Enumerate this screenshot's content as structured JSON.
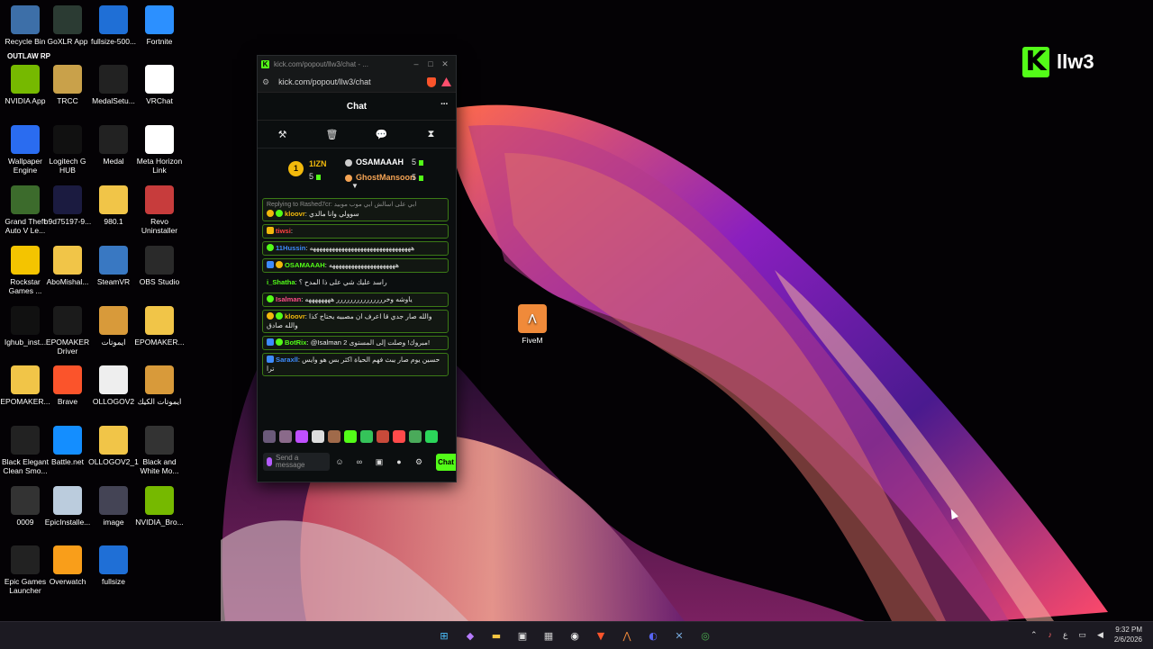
{
  "desktop": {
    "icons": [
      {
        "label": "Recycle Bin",
        "icon": "recycle-bin-icon",
        "color": "#3d6fa8"
      },
      {
        "label": "GoXLR App",
        "icon": "goxlr-icon",
        "color": "#2b3b33"
      },
      {
        "label": "fullsize-500...",
        "icon": "olontop-icon",
        "color": "#1f6fd6"
      },
      {
        "label": "Fortnite",
        "icon": "fortnite-icon",
        "color": "#2c90ff"
      },
      {
        "label": "NVIDIA App",
        "icon": "nvidia-icon",
        "color": "#76b900"
      },
      {
        "label": "TRCC",
        "icon": "trcc-icon",
        "color": "#c9a14a"
      },
      {
        "label": "MedalSetu...",
        "icon": "medal-icon",
        "color": "#222"
      },
      {
        "label": "VRChat",
        "icon": "vrchat-icon",
        "color": "#ffffff"
      },
      {
        "label": "Wallpaper Engine",
        "icon": "wallpaper-engine-icon",
        "color": "#2a6cf0"
      },
      {
        "label": "Logitech G HUB",
        "icon": "logitech-icon",
        "color": "#111"
      },
      {
        "label": "Medal",
        "icon": "medal-icon",
        "color": "#222"
      },
      {
        "label": "Meta Horizon Link",
        "icon": "meta-icon",
        "color": "#ffffff"
      },
      {
        "label": "Grand Theft Auto V Le...",
        "icon": "gta-icon",
        "color": "#3c6b2c"
      },
      {
        "label": "b9d75197-9...",
        "icon": "file-icon",
        "color": "#1b1b40"
      },
      {
        "label": "980.1",
        "icon": "folder-icon",
        "color": "#f1c548"
      },
      {
        "label": "Revo Uninstaller",
        "icon": "revo-icon",
        "color": "#c73c3c"
      },
      {
        "label": "Rockstar Games ...",
        "icon": "rockstar-icon",
        "color": "#f4c400"
      },
      {
        "label": "AboMishal...",
        "icon": "folder-icon",
        "color": "#f1c548"
      },
      {
        "label": "SteamVR",
        "icon": "steamvr-icon",
        "color": "#3978c2"
      },
      {
        "label": "OBS Studio",
        "icon": "obs-icon",
        "color": "#2a2a2a"
      },
      {
        "label": "Ighub_inst...",
        "icon": "logitech-icon",
        "color": "#111"
      },
      {
        "label": "EPOMAKER Driver",
        "icon": "epomaker-icon",
        "color": "#1b1b1b"
      },
      {
        "label": "ايموتات",
        "icon": "folder-image-icon",
        "color": "#d89a3a"
      },
      {
        "label": "EPOMAKER...",
        "icon": "folder-icon",
        "color": "#f1c548"
      },
      {
        "label": "EPOMAKER...",
        "icon": "folder-icon",
        "color": "#f1c548"
      },
      {
        "label": "Brave",
        "icon": "brave-icon",
        "color": "#fb542b"
      },
      {
        "label": "OLLOGOV2",
        "icon": "video-file-icon",
        "color": "#eeeeee"
      },
      {
        "label": "ايموتات الكيك",
        "icon": "folder-image-icon",
        "color": "#d89a3a"
      },
      {
        "label": "Black Elegant Clean Smo...",
        "icon": "video-file-icon",
        "color": "#222"
      },
      {
        "label": "Battle.net",
        "icon": "battlenet-icon",
        "color": "#148eff"
      },
      {
        "label": "OLLOGOV2_1",
        "icon": "folder-icon",
        "color": "#f1c548"
      },
      {
        "label": "Black and White Mo...",
        "icon": "video-file-icon",
        "color": "#333"
      },
      {
        "label": "0009",
        "icon": "video-file-icon",
        "color": "#333"
      },
      {
        "label": "EpicInstalle...",
        "icon": "disc-icon",
        "color": "#bcd"
      },
      {
        "label": "image",
        "icon": "image-file-icon",
        "color": "#445"
      },
      {
        "label": "NVIDIA_Bro...",
        "icon": "nvidia-icon",
        "color": "#76b900"
      },
      {
        "label": "Epic Games Launcher",
        "icon": "epic-icon",
        "color": "#222"
      },
      {
        "label": "Overwatch",
        "icon": "overwatch-icon",
        "color": "#f99e1a"
      },
      {
        "label": "fullsize",
        "icon": "olontop-icon",
        "color": "#1f6fd6"
      }
    ],
    "fivem_label": "FiveM",
    "brand_text": "llw3",
    "brand_mark": "K",
    "outlaw_text": "OUTLAW RP"
  },
  "window": {
    "title": "kick.com/popout/llw3/chat - ...",
    "url": "kick.com/popout/llw3/chat",
    "minimize": "–",
    "maximize": "□",
    "close": "✕"
  },
  "chat": {
    "header": "Chat",
    "menu": "···",
    "leaderboard": {
      "rank": "1",
      "top_user": "1IZN",
      "top_count": "5",
      "second_user": "OSAMAAAH",
      "second_count": "5",
      "third_user": "GhostMansoori",
      "third_count": "5"
    },
    "messages": [
      {
        "reply": "Replying to Rashed7cr: ابي على اسالش ابي موب موبيد",
        "user": "kloovr",
        "user_color": "#f2b90c",
        "text": "سوولي وانا مالدي",
        "badges": [
          "gold",
          "green"
        ],
        "boxed": true
      },
      {
        "user": "tiwsi",
        "user_color": "#ff4040",
        "text": "",
        "badges": [
          "crown"
        ],
        "boxed": true
      },
      {
        "user": "11Hussin",
        "user_color": "#3d8bfd",
        "text": "ههههههههههههههههههههههههههههههههه",
        "badges": [
          "green"
        ],
        "boxed": true
      },
      {
        "user": "OSAMAAAH",
        "user_color": "#53fc18",
        "text": "هههههههههههههههههههههه",
        "badges": [
          "blue",
          "gold"
        ],
        "boxed": true
      },
      {
        "user": "i_Shatha",
        "user_color": "#53fc18",
        "text": "راسد عليك شي على ذا المدح ؟",
        "badges": [],
        "boxed": false
      },
      {
        "user": "Isalman",
        "user_color": "#ff4d88",
        "text": "ياوشه وخررررررررررررررر ههههههههه",
        "badges": [
          "green"
        ],
        "boxed": true
      },
      {
        "user": "kloovr",
        "user_color": "#f2b90c",
        "text": "والله صار جدي قا اعرف ان مصبيه يحتاج كذا والله صادق",
        "badges": [
          "gold",
          "green"
        ],
        "boxed": true
      },
      {
        "user": "BotRix",
        "user_color": "#53fc18",
        "text": "@Isalman مبروك! وصلت إلى المستوى 2!",
        "badges": [
          "blue",
          "green"
        ],
        "boxed": true
      },
      {
        "user": "Saraxll",
        "user_color": "#3d8bfd",
        "text": "حسين يوم صار يبث فهم الحياة اكثر بس هو وايس ترا",
        "badges": [
          "blue"
        ],
        "boxed": true
      }
    ],
    "input_placeholder": "Send a message",
    "send_label": "Chat"
  },
  "taskbar": {
    "apps": [
      "windows-start-icon",
      "copilot-icon",
      "file-explorer-icon",
      "store-icon",
      "calculator-icon",
      "obs-icon",
      "brave-icon",
      "fivem-icon",
      "discord-icon",
      "goxlr-icon",
      "chrome-icon"
    ],
    "tray_lang": "ع",
    "time": "9:32 PM",
    "date": "2/6/2026"
  },
  "colors": {
    "kick_green": "#53fc18",
    "taskbar": "#1c1a22",
    "chat_bg": "#0b0e0f"
  }
}
